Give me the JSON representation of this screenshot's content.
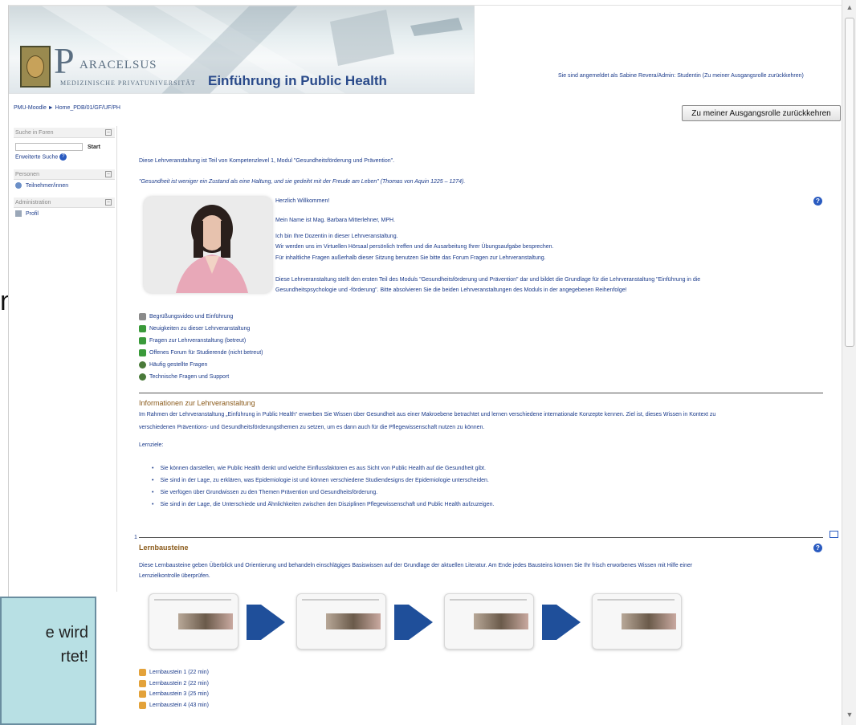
{
  "overlay": {
    "left_letter": "n",
    "callout_line1": "e wird",
    "callout_line2": "rtet!"
  },
  "header": {
    "logo_initial": "P",
    "logo_name": "ARACELSUS",
    "logo_sub": "MEDIZINISCHE PRIVATUNIVERSITÄT",
    "course_title": "Einführung in Public Health",
    "login_info": "Sie sind angemeldet als Sabine Revera/Admin: Studentin (Zu meiner Ausgangsrolle zurückkehren)",
    "breadcrumb": "PMU-Moodle ► Home_PDB/01/GF/UF/PH",
    "role_button": "Zu meiner Ausgangsrolle zurückkehren"
  },
  "sidebar": {
    "search_block_title": "Suche in Foren",
    "search_placeholder": "",
    "search_button": "Start",
    "advanced_search": "Erweiterte Suche",
    "people_block_title": "Personen",
    "participants": "Teilnehmer/innen",
    "admin_block_title": "Administration",
    "profile": "Profil"
  },
  "main": {
    "intro_1": "Diese Lehrveranstaltung ist Teil von Kompetenzlevel 1, Modul \"Gesundheitsförderung und Prävention\".",
    "intro_2": "\"Gesundheit ist weniger ein Zustand als eine Haltung, und sie gedeiht mit der Freude am Leben\" (Thomas von Aquin 1225 – 1274).",
    "welcome": "Herzlich Willkommen!",
    "name_line": "Mein Name ist Mag. Barbara Mitterlehner, MPH.",
    "text_1": "Ich bin Ihre Dozentin in dieser Lehrveranstaltung.",
    "text_2": "Wir werden uns im Virtuellen Hörsaal persönlich treffen und die Ausarbeitung Ihrer Übungsaufgabe besprechen.",
    "text_3": "Für inhaltliche Fragen außerhalb dieser Sitzung benutzen Sie bitte das Forum Fragen zur Lehrveranstaltung.",
    "text_4": "Diese Lehrveranstaltung stellt den ersten Teil des Moduls \"Gesundheitsförderung und Prävention\" dar und bildet die Grundlage für die Lehrveranstaltung \"Einführung in die",
    "text_5": "Gesundheitspsychologie und -förderung\". Bitte absolvieren Sie die beiden Lehrveranstaltungen des Moduls in der angegebenen Reihenfolge!",
    "links": [
      {
        "label": "Begrüßungsvideo und Einführung",
        "icon": "video-icon",
        "color": "#8a8a8a"
      },
      {
        "label": "Neuigkeiten zu dieser Lehrveranstaltung",
        "icon": "forum-icon",
        "color": "#3a9a3a"
      },
      {
        "label": "Fragen zur Lehrveranstaltung (betreut)",
        "icon": "forum-icon",
        "color": "#3a9a3a"
      },
      {
        "label": "Offenes Forum für Studierende (nicht betreut)",
        "icon": "forum-icon",
        "color": "#3a9a3a"
      },
      {
        "label": "Häufig gestellte Fragen",
        "icon": "globe-icon",
        "color": "#4a7a3a"
      },
      {
        "label": "Technische Fragen und Support",
        "icon": "globe-icon",
        "color": "#4a7a3a"
      }
    ],
    "info_title": "Informationen zur Lehrveranstaltung",
    "info_text_1": "Im Rahmen der Lehrveranstaltung „Einführung in Public Health“ erwerben Sie Wissen über Gesundheit aus einer Makroebene betrachtet und lernen verschiedene internationale Konzepte kennen. Ziel ist, dieses Wissen in Kontext zu",
    "info_text_2": "verschiedenen Präventions- und Gesundheitsförderungsthemen zu setzen, um es dann auch für die Pflegewissenschaft nutzen zu können.",
    "goals_label": "Lernziele:",
    "goals": [
      "Sie können darstellen, wie Public Health denkt und welche Einflussfaktoren es aus Sicht von Public Health auf die Gesundheit gibt.",
      "Sie sind in der Lage, zu erklären, was Epidemiologie ist und können verschiedene Studiendesigns der Epidemiologie unterscheiden.",
      "Sie verfügen über Grundwissen zu den Themen Prävention und Gesundheitsförderung.",
      "Sie sind in der Lage, die Unterschiede und Ähnlichkeiten zwischen den Disziplinen Pflegewissenschaft und Public Health aufzuzeigen."
    ],
    "section_number": "1",
    "lern_title": "Lernbausteine",
    "lern_text_1": "Diese Lernbausteine geben Überblick und Orientierung und behandeln einschlägiges Basiswissen auf der Grundlage der aktuellen Literatur. Am Ende jedes Bausteins können Sie Ihr frisch erworbenes Wissen mit Hilfe einer",
    "lern_text_2": "Lernzielkontrolle überprüfen.",
    "lern_items": [
      "Lernbaustein 1 (22 min)",
      "Lernbaustein 2 (22 min)",
      "Lernbaustein 3 (25 min)",
      "Lernbaustein 4 (43 min)"
    ]
  },
  "colors": {
    "link": "#1a3a8a",
    "section_title": "#8a5a1a",
    "arrow": "#1f4f9a",
    "callout_bg": "#b8e0e4"
  }
}
